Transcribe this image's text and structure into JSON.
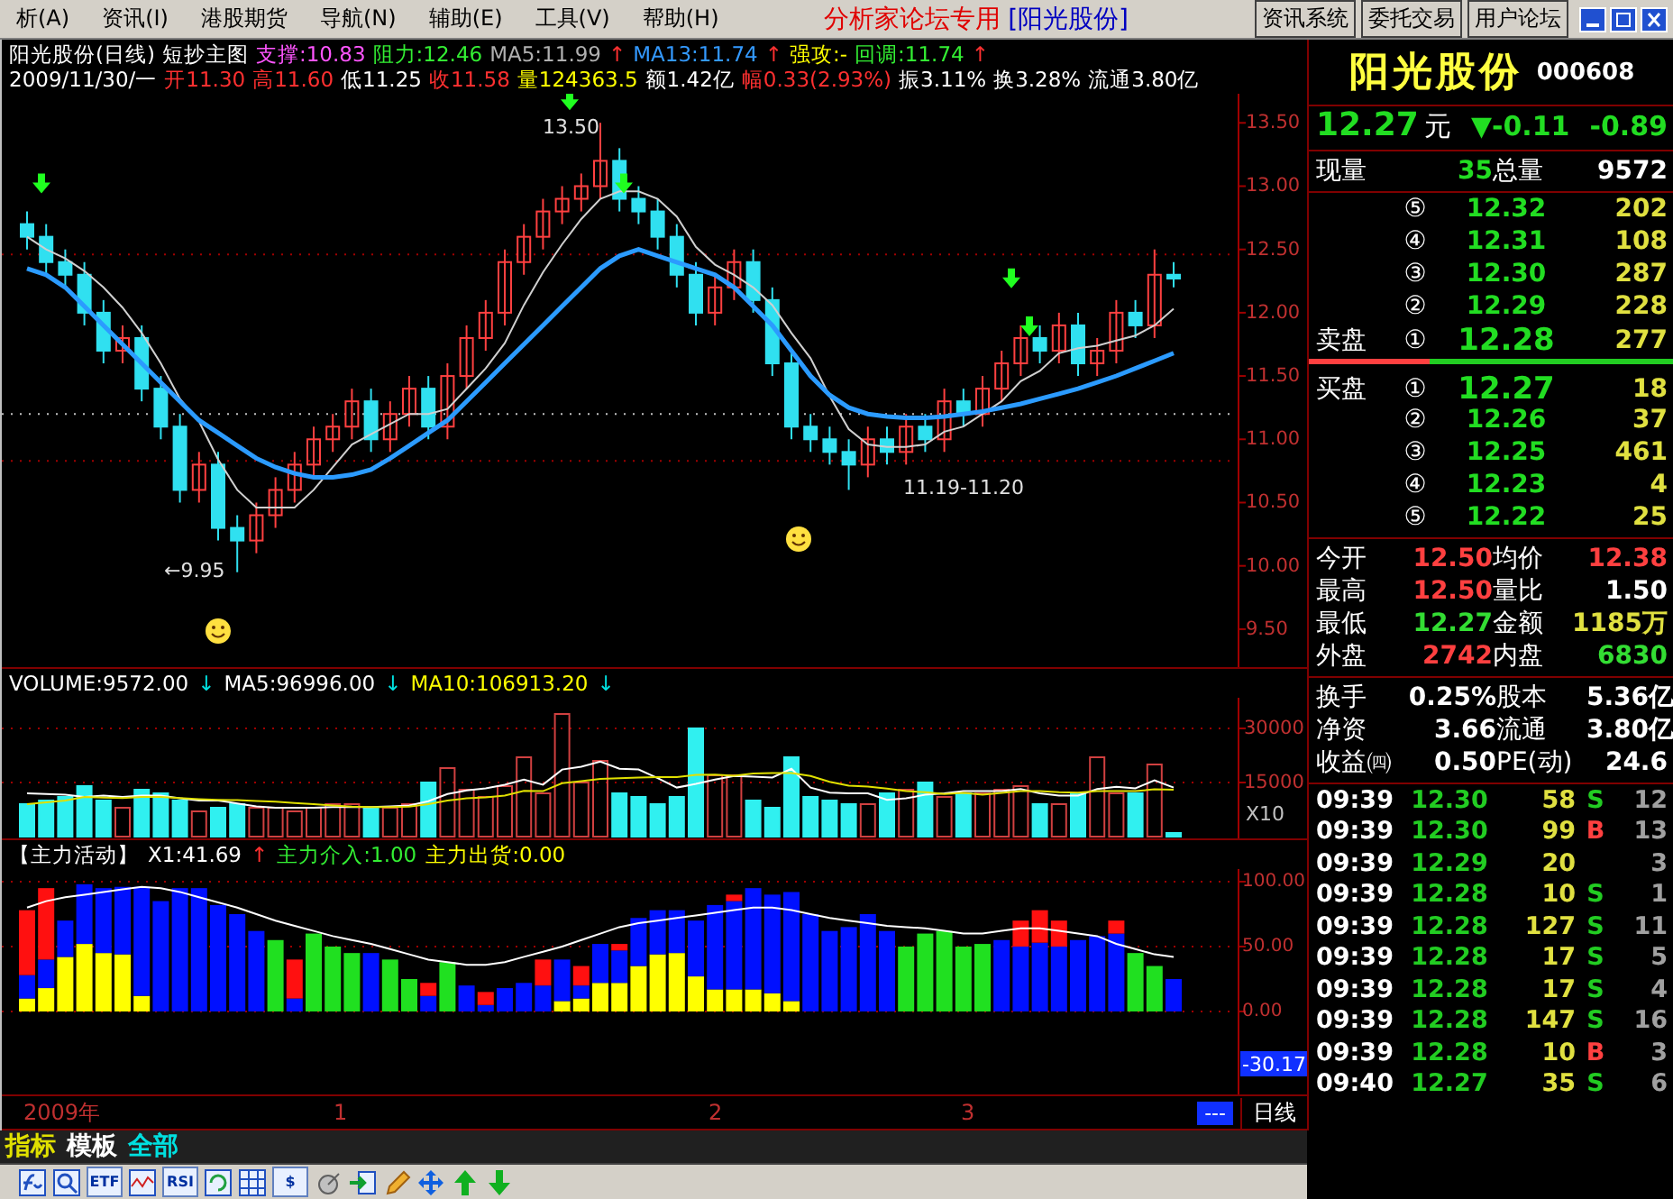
{
  "menu": [
    "析(A)",
    "资讯(I)",
    "港股期货",
    "导航(N)",
    "辅助(E)",
    "工具(V)",
    "帮助(H)"
  ],
  "banner": {
    "title": "分析家论坛专用",
    "stock": "[阳光股份]"
  },
  "top_buttons": [
    "资讯系统",
    "委托交易",
    "用户论坛"
  ],
  "chart_header": {
    "line1": [
      {
        "text": "阳光股份(日线)",
        "color": "#ffffff"
      },
      {
        "text": "短抄主图",
        "color": "#ffffff"
      },
      {
        "text": "支撑:10.83",
        "color": "#ff55ff"
      },
      {
        "text": "阻力:12.46",
        "color": "#33ee33"
      },
      {
        "text": "MA5:11.99",
        "color": "#b0b0b0"
      },
      {
        "text": "↑",
        "color": "#ff3030"
      },
      {
        "text": "MA13:11.74",
        "color": "#3399ff"
      },
      {
        "text": "↑",
        "color": "#ff3030"
      },
      {
        "text": "强攻:-",
        "color": "#ffff00"
      },
      {
        "text": "回调:11.74",
        "color": "#33ee33"
      },
      {
        "text": "↑",
        "color": "#ff3030"
      }
    ],
    "line2": [
      {
        "text": "2009/11/30/一",
        "color": "#ffffff"
      },
      {
        "text": "开11.30",
        "color": "#ff3030"
      },
      {
        "text": "高11.60",
        "color": "#ff3030"
      },
      {
        "text": "低11.25",
        "color": "#ffffff"
      },
      {
        "text": "收11.58",
        "color": "#ff3030"
      },
      {
        "text": "量124363.5",
        "color": "#ffff00"
      },
      {
        "text": "额1.42亿",
        "color": "#ffffff"
      },
      {
        "text": "幅0.33(2.93%)",
        "color": "#ff3030"
      },
      {
        "text": "振3.11%",
        "color": "#ffffff"
      },
      {
        "text": "换3.28%",
        "color": "#ffffff"
      },
      {
        "text": "流通3.80亿",
        "color": "#ffffff"
      }
    ]
  },
  "price_chart": {
    "chart_data": {
      "type": "candlestick",
      "ylim": [
        9.2,
        13.73
      ],
      "yticks": [
        {
          "value": 13.5,
          "label": "13.50"
        },
        {
          "value": 13.0,
          "label": "13.00"
        },
        {
          "value": 12.5,
          "label": "12.50"
        },
        {
          "value": 12.0,
          "label": "12.00"
        },
        {
          "value": 11.5,
          "label": "11.50"
        },
        {
          "value": 11.0,
          "label": "11.00"
        },
        {
          "value": 10.5,
          "label": "10.50"
        },
        {
          "value": 10.0,
          "label": "10.00"
        },
        {
          "value": 9.5,
          "label": "9.50"
        }
      ],
      "ohlc": [
        [
          12.7,
          12.8,
          12.5,
          12.6
        ],
        [
          12.6,
          12.7,
          12.3,
          12.4
        ],
        [
          12.4,
          12.5,
          12.2,
          12.3
        ],
        [
          12.3,
          12.4,
          11.9,
          12.0
        ],
        [
          12.0,
          12.1,
          11.6,
          11.7
        ],
        [
          11.7,
          11.9,
          11.6,
          11.8
        ],
        [
          11.8,
          11.9,
          11.3,
          11.4
        ],
        [
          11.4,
          11.5,
          11.0,
          11.1
        ],
        [
          11.1,
          11.2,
          10.5,
          10.6
        ],
        [
          10.6,
          10.9,
          10.5,
          10.8
        ],
        [
          10.8,
          10.9,
          10.2,
          10.3
        ],
        [
          10.3,
          10.4,
          9.95,
          10.2
        ],
        [
          10.2,
          10.5,
          10.1,
          10.4
        ],
        [
          10.4,
          10.7,
          10.3,
          10.6
        ],
        [
          10.6,
          10.9,
          10.5,
          10.8
        ],
        [
          10.8,
          11.1,
          10.7,
          11.0
        ],
        [
          11.0,
          11.2,
          10.9,
          11.1
        ],
        [
          11.1,
          11.4,
          11.0,
          11.3
        ],
        [
          11.3,
          11.4,
          10.9,
          11.0
        ],
        [
          11.0,
          11.3,
          10.9,
          11.2
        ],
        [
          11.2,
          11.5,
          11.1,
          11.4
        ],
        [
          11.4,
          11.5,
          11.0,
          11.1
        ],
        [
          11.1,
          11.6,
          11.0,
          11.5
        ],
        [
          11.5,
          11.9,
          11.4,
          11.8
        ],
        [
          11.8,
          12.1,
          11.7,
          12.0
        ],
        [
          12.0,
          12.5,
          11.9,
          12.4
        ],
        [
          12.4,
          12.7,
          12.3,
          12.6
        ],
        [
          12.6,
          12.9,
          12.5,
          12.8
        ],
        [
          12.8,
          13.0,
          12.7,
          12.9
        ],
        [
          12.9,
          13.1,
          12.8,
          13.0
        ],
        [
          13.0,
          13.5,
          12.9,
          13.2
        ],
        [
          13.2,
          13.3,
          12.8,
          12.9
        ],
        [
          12.9,
          13.0,
          12.7,
          12.8
        ],
        [
          12.8,
          12.9,
          12.5,
          12.6
        ],
        [
          12.6,
          12.7,
          12.2,
          12.3
        ],
        [
          12.3,
          12.4,
          11.9,
          12.0
        ],
        [
          12.0,
          12.3,
          11.9,
          12.2
        ],
        [
          12.2,
          12.5,
          12.1,
          12.4
        ],
        [
          12.4,
          12.5,
          12.0,
          12.1
        ],
        [
          12.1,
          12.2,
          11.5,
          11.6
        ],
        [
          11.6,
          11.7,
          11.0,
          11.1
        ],
        [
          11.1,
          11.2,
          10.9,
          11.0
        ],
        [
          11.0,
          11.1,
          10.8,
          10.9
        ],
        [
          10.9,
          11.0,
          10.6,
          10.8
        ],
        [
          10.8,
          11.1,
          10.7,
          11.0
        ],
        [
          11.0,
          11.1,
          10.8,
          10.9
        ],
        [
          10.9,
          11.2,
          10.8,
          11.1
        ],
        [
          11.1,
          11.2,
          10.9,
          11.0
        ],
        [
          11.0,
          11.4,
          10.9,
          11.3
        ],
        [
          11.3,
          11.4,
          11.1,
          11.2
        ],
        [
          11.2,
          11.5,
          11.1,
          11.4
        ],
        [
          11.4,
          11.7,
          11.3,
          11.6
        ],
        [
          11.6,
          11.9,
          11.5,
          11.8
        ],
        [
          11.8,
          11.9,
          11.6,
          11.7
        ],
        [
          11.7,
          12.0,
          11.6,
          11.9
        ],
        [
          11.9,
          12.0,
          11.5,
          11.6
        ],
        [
          11.6,
          11.8,
          11.5,
          11.7
        ],
        [
          11.7,
          12.1,
          11.6,
          12.0
        ],
        [
          12.0,
          12.1,
          11.8,
          11.9
        ],
        [
          11.9,
          12.5,
          11.8,
          12.3
        ],
        [
          12.3,
          12.4,
          12.2,
          12.27
        ]
      ],
      "series": [
        {
          "type": "line",
          "color": "#d0d0d0",
          "values": [
            12.6,
            12.5,
            12.43,
            12.33,
            12.2,
            12.04,
            11.84,
            11.6,
            11.32,
            11.14,
            10.84,
            10.6,
            10.46,
            10.46,
            10.46,
            10.6,
            10.78,
            10.96,
            11.04,
            11.12,
            11.2,
            11.2,
            11.24,
            11.4,
            11.56,
            11.76,
            12.06,
            12.32,
            12.54,
            12.74,
            12.9,
            12.96,
            12.96,
            12.9,
            12.76,
            12.52,
            12.38,
            12.3,
            12.2,
            12.06,
            11.84,
            11.64,
            11.34,
            11.08,
            10.96,
            10.94,
            10.94,
            10.96,
            11.06,
            11.1,
            11.2,
            11.3,
            11.46,
            11.54,
            11.68,
            11.72,
            11.74,
            11.78,
            11.82,
            11.9,
            12.03
          ]
        },
        {
          "type": "line",
          "color": "#2b9bff",
          "values": [
            12.35,
            12.3,
            12.2,
            12.05,
            11.9,
            11.75,
            11.6,
            11.45,
            11.3,
            11.15,
            11.05,
            10.95,
            10.85,
            10.78,
            10.73,
            10.7,
            10.7,
            10.72,
            10.76,
            10.85,
            10.95,
            11.05,
            11.15,
            11.3,
            11.45,
            11.6,
            11.75,
            11.9,
            12.05,
            12.2,
            12.35,
            12.45,
            12.5,
            12.45,
            12.4,
            12.35,
            12.3,
            12.2,
            12.05,
            11.9,
            11.7,
            11.5,
            11.35,
            11.25,
            11.2,
            11.18,
            11.17,
            11.17,
            11.18,
            11.2,
            11.22,
            11.25,
            11.28,
            11.32,
            11.36,
            11.4,
            11.45,
            11.5,
            11.56,
            11.62,
            11.68
          ]
        }
      ],
      "ref_lines": [
        {
          "axis": "y",
          "value": 10.83,
          "color": "#a00000"
        },
        {
          "axis": "y",
          "value": 12.46,
          "color": "#a00000"
        },
        {
          "axis": "y",
          "value": 11.2,
          "color": "#c0c0c0"
        }
      ]
    },
    "annotations": [
      {
        "kind": "peak",
        "text": "13.50"
      },
      {
        "kind": "low",
        "text": "←9.95"
      },
      {
        "kind": "range",
        "text": "11.19-11.20"
      }
    ]
  },
  "volume_chart": {
    "header": [
      {
        "text": "VOLUME:9572.00",
        "color": "#ffffff"
      },
      {
        "text": "↓",
        "color": "#00e0e0"
      },
      {
        "text": "MA5:96996.00",
        "color": "#ffffff"
      },
      {
        "text": "↓",
        "color": "#00e0e0"
      },
      {
        "text": "MA10:106913.20",
        "color": "#ffff00"
      },
      {
        "text": "↓",
        "color": "#00e0e0"
      }
    ],
    "chart_data": {
      "type": "bar",
      "grid": true,
      "ylim": [
        -1000,
        38500
      ],
      "yticks": [
        {
          "value": 30000,
          "label": "30000"
        },
        {
          "value": 15000,
          "label": "15000"
        }
      ],
      "series": [
        {
          "type": "bar",
          "colors": [
            "#30f0f0",
            "#30f0f0",
            "#30f0f0",
            "#30f0f0",
            "#30f0f0",
            "#d04040",
            "#30f0f0",
            "#30f0f0",
            "#30f0f0",
            "#d04040",
            "#30f0f0",
            "#30f0f0",
            "#d04040",
            "#d04040",
            "#d04040",
            "#d04040",
            "#d04040",
            "#d04040",
            "#30f0f0",
            "#d04040",
            "#d04040",
            "#30f0f0",
            "#d04040",
            "#d04040",
            "#d04040",
            "#d04040",
            "#d04040",
            "#d04040",
            "#d04040",
            "#d04040",
            "#d04040",
            "#30f0f0",
            "#30f0f0",
            "#30f0f0",
            "#30f0f0",
            "#30f0f0",
            "#d04040",
            "#d04040",
            "#30f0f0",
            "#30f0f0",
            "#30f0f0",
            "#30f0f0",
            "#30f0f0",
            "#30f0f0",
            "#d04040",
            "#30f0f0",
            "#d04040",
            "#30f0f0",
            "#d04040",
            "#30f0f0",
            "#d04040",
            "#d04040",
            "#d04040",
            "#30f0f0",
            "#d04040",
            "#30f0f0",
            "#d04040",
            "#d04040",
            "#30f0f0",
            "#d04040",
            "#30f0f0"
          ],
          "values": [
            9000,
            10000,
            11000,
            14000,
            10000,
            8000,
            13000,
            12000,
            10000,
            7000,
            8000,
            9000,
            8000,
            8000,
            7000,
            8000,
            9000,
            9000,
            8000,
            8000,
            9000,
            15000,
            19000,
            13000,
            11000,
            14000,
            22000,
            12000,
            34000,
            15000,
            21000,
            12000,
            11000,
            9000,
            11000,
            30000,
            17000,
            17000,
            10000,
            8000,
            22000,
            11000,
            10000,
            9000,
            9000,
            12000,
            13000,
            15000,
            11000,
            12000,
            12000,
            13000,
            14000,
            9000,
            9000,
            12000,
            22000,
            12000,
            12000,
            20000,
            1000
          ]
        },
        {
          "type": "line",
          "color": "#ffffff",
          "values": [
            12000,
            11800,
            11600,
            11000,
            11400,
            11000,
            11400,
            11400,
            10600,
            10000,
            10000,
            9200,
            8400,
            8000,
            8000,
            8000,
            8200,
            8200,
            8200,
            8400,
            8600,
            9800,
            11800,
            12800,
            13400,
            14400,
            15800,
            14400,
            18600,
            19400,
            20800,
            18800,
            18600,
            16200,
            13600,
            14600,
            15800,
            16800,
            16600,
            16400,
            18800,
            13600,
            12200,
            12000,
            12000,
            10200,
            10600,
            11600,
            12000,
            12600,
            12600,
            12600,
            13200,
            12000,
            11400,
            11400,
            13200,
            13800,
            13400,
            15600,
            13600
          ]
        },
        {
          "type": "line",
          "color": "#e0e000",
          "values": [
            9000,
            9500,
            10000,
            11000,
            10800,
            10700,
            11000,
            11000,
            10700,
            10400,
            10200,
            10100,
            9900,
            9700,
            9300,
            9000,
            8600,
            8300,
            8200,
            8200,
            8300,
            9000,
            10000,
            10600,
            10900,
            11400,
            12700,
            12600,
            14800,
            15400,
            16000,
            16200,
            16400,
            16500,
            16500,
            17100,
            17200,
            16900,
            17500,
            17600,
            17600,
            16800,
            15200,
            14100,
            13900,
            13300,
            12600,
            12300,
            11800,
            12100,
            11600,
            12100,
            12600,
            12600,
            12300,
            12200,
            12600,
            12600,
            12600,
            13100,
            13000
          ]
        }
      ]
    },
    "scale": "X10"
  },
  "indicator_chart": {
    "header": [
      {
        "text": "【主力活动】",
        "color": "#ffffff"
      },
      {
        "text": "X1:41.69",
        "color": "#ffffff"
      },
      {
        "text": "↑",
        "color": "#ff3030"
      },
      {
        "text": "主力介入:1.00",
        "color": "#33ee33"
      },
      {
        "text": "主力出货:0.00",
        "color": "#ffff00"
      }
    ],
    "chart_data": {
      "type": "bar",
      "stacked": true,
      "grid": true,
      "ylim": [
        -65.3,
        109.7
      ],
      "yticks": [
        {
          "value": 100,
          "label": "100.00"
        },
        {
          "value": 50,
          "label": "50.00"
        },
        {
          "value": 0,
          "label": "0.00"
        }
      ],
      "series": [
        {
          "type": "bar",
          "color": "#ffff00",
          "values": [
            10,
            18,
            42,
            52,
            45,
            44,
            12,
            0,
            0,
            0,
            0,
            0,
            0,
            0,
            0,
            0,
            0,
            0,
            0,
            0,
            0,
            0,
            0,
            0,
            0,
            0,
            0,
            0,
            8,
            10,
            22,
            22,
            35,
            44,
            45,
            27,
            17,
            17,
            17,
            14,
            8,
            0,
            0,
            0,
            0,
            0,
            0,
            0,
            0,
            0,
            0,
            0,
            0,
            0,
            0,
            0,
            0,
            0,
            0,
            0,
            0
          ]
        },
        {
          "type": "bar",
          "color": "#0010ff",
          "values": [
            18,
            22,
            28,
            46,
            50,
            52,
            84,
            85,
            95,
            95,
            82,
            75,
            62,
            0,
            10,
            0,
            0,
            0,
            45,
            0,
            0,
            12,
            0,
            20,
            5,
            18,
            22,
            20,
            32,
            10,
            30,
            25,
            37,
            34,
            33,
            43,
            65,
            68,
            78,
            76,
            84,
            75,
            62,
            65,
            75,
            62,
            0,
            0,
            0,
            0,
            0,
            55,
            50,
            53,
            50,
            55,
            58,
            60,
            0,
            0,
            25
          ]
        },
        {
          "type": "bar",
          "color": "#20e020",
          "values": [
            0,
            0,
            0,
            0,
            0,
            0,
            0,
            0,
            0,
            0,
            0,
            0,
            0,
            55,
            0,
            60,
            50,
            45,
            0,
            40,
            25,
            0,
            38,
            0,
            0,
            0,
            0,
            0,
            0,
            0,
            0,
            0,
            0,
            0,
            0,
            0,
            0,
            0,
            0,
            0,
            0,
            0,
            0,
            0,
            0,
            0,
            50,
            60,
            62,
            50,
            52,
            0,
            0,
            0,
            0,
            0,
            0,
            0,
            45,
            35,
            0
          ]
        },
        {
          "type": "bar",
          "color": "#ff1010",
          "values": [
            50,
            55,
            0,
            0,
            0,
            0,
            0,
            0,
            0,
            0,
            0,
            0,
            0,
            0,
            30,
            0,
            0,
            0,
            0,
            0,
            0,
            10,
            0,
            0,
            10,
            0,
            0,
            20,
            0,
            15,
            0,
            5,
            0,
            0,
            0,
            0,
            0,
            5,
            0,
            0,
            0,
            0,
            0,
            0,
            0,
            0,
            0,
            0,
            0,
            0,
            0,
            0,
            20,
            25,
            20,
            0,
            0,
            10,
            0,
            0,
            0
          ]
        },
        {
          "type": "line",
          "color": "#ffffff",
          "values": [
            80,
            85,
            88,
            90,
            92,
            94,
            96,
            95,
            92,
            88,
            84,
            80,
            75,
            70,
            66,
            62,
            58,
            55,
            52,
            48,
            44,
            40,
            38,
            36,
            36,
            38,
            42,
            46,
            50,
            55,
            60,
            65,
            68,
            70,
            72,
            74,
            76,
            78,
            80,
            80,
            78,
            75,
            72,
            70,
            68,
            66,
            65,
            64,
            62,
            60,
            60,
            62,
            64,
            64,
            62,
            60,
            58,
            52,
            48,
            44,
            42
          ]
        }
      ]
    },
    "current": "-30.17"
  },
  "time_axis": {
    "labels": [
      "2009年",
      "1",
      "2",
      "3"
    ],
    "marker": "---",
    "period": "日线"
  },
  "bottom_tabs": [
    {
      "label": "指标",
      "color": "#e0e000"
    },
    {
      "label": "模板",
      "color": "#ffffff"
    },
    {
      "label": "全部",
      "color": "#00e0e0"
    }
  ],
  "toolbar": [
    {
      "kind": "formula"
    },
    {
      "kind": "search"
    },
    {
      "kind": "text",
      "label": "ETF"
    },
    {
      "kind": "wave"
    },
    {
      "kind": "text",
      "label": "RSI"
    },
    {
      "kind": "refresh"
    },
    {
      "kind": "grid"
    },
    {
      "kind": "text",
      "label": "$"
    },
    {
      "kind": "satellite"
    },
    {
      "kind": "enter"
    },
    {
      "kind": "pencil"
    },
    {
      "kind": "move"
    },
    {
      "kind": "up"
    },
    {
      "kind": "down"
    }
  ],
  "quote": {
    "name": "阳光股份",
    "code": "000608",
    "price": "12.27",
    "unit": "元",
    "change": "▼-0.11",
    "change_pct": "-0.89"
  },
  "volume_summary": [
    {
      "label": "现量",
      "value": "35"
    },
    {
      "label": "总量",
      "value": "9572"
    }
  ],
  "asks": [
    {
      "level": "⑤",
      "price": "12.32",
      "qty": "202"
    },
    {
      "level": "④",
      "price": "12.31",
      "qty": "108"
    },
    {
      "level": "③",
      "price": "12.30",
      "qty": "287"
    },
    {
      "level": "②",
      "price": "12.29",
      "qty": "228"
    },
    {
      "side": "卖盘",
      "level": "①",
      "price": "12.28",
      "qty": "277"
    }
  ],
  "order_bar": {
    "level": 0.33
  },
  "bids": [
    {
      "side": "买盘",
      "level": "①",
      "price": "12.27",
      "qty": "18"
    },
    {
      "level": "②",
      "price": "12.26",
      "qty": "37"
    },
    {
      "level": "③",
      "price": "12.25",
      "qty": "461"
    },
    {
      "level": "④",
      "price": "12.23",
      "qty": "4"
    },
    {
      "level": "⑤",
      "price": "12.22",
      "qty": "25"
    }
  ],
  "stats": [
    {
      "cells": [
        {
          "label": "今开",
          "value": "12.50",
          "color": "#ff4040"
        },
        {
          "label": "均价",
          "value": "12.38",
          "color": "#ff4040"
        }
      ]
    },
    {
      "cells": [
        {
          "label": "最高",
          "value": "12.50",
          "color": "#ff4040"
        },
        {
          "label": "量比",
          "value": "1.50",
          "color": "#ffffff"
        }
      ]
    },
    {
      "cells": [
        {
          "label": "最低",
          "value": "12.27",
          "color": "#33dd33"
        },
        {
          "label": "金额",
          "value": "1185万",
          "color": "#e0e040"
        }
      ]
    },
    {
      "cells": [
        {
          "label": "外盘",
          "value": "2742",
          "color": "#ff4040"
        },
        {
          "label": "内盘",
          "value": "6830",
          "color": "#33dd33"
        }
      ]
    }
  ],
  "fundamentals": [
    {
      "cells": [
        {
          "label": "换手",
          "value": "0.25%"
        },
        {
          "label": "股本",
          "value": "5.36亿"
        }
      ]
    },
    {
      "cells": [
        {
          "label": "净资",
          "value": "3.66"
        },
        {
          "label": "流通",
          "value": "3.80亿"
        }
      ]
    },
    {
      "cells": [
        {
          "label": "收益㈣",
          "value": "0.50"
        },
        {
          "label": "PE(动)",
          "value": "24.6"
        }
      ]
    }
  ],
  "trades": [
    {
      "time": "09:39",
      "price": "12.30",
      "volume": "58",
      "side": "S",
      "kind": "sell",
      "count": "12"
    },
    {
      "time": "09:39",
      "price": "12.30",
      "volume": "99",
      "side": "B",
      "kind": "buy",
      "count": "13"
    },
    {
      "time": "09:39",
      "price": "12.29",
      "volume": "20",
      "count": "3"
    },
    {
      "time": "09:39",
      "price": "12.28",
      "volume": "10",
      "side": "S",
      "kind": "sell",
      "count": "1"
    },
    {
      "time": "09:39",
      "price": "12.28",
      "volume": "127",
      "side": "S",
      "kind": "sell",
      "count": "11"
    },
    {
      "time": "09:39",
      "price": "12.28",
      "volume": "17",
      "side": "S",
      "kind": "sell",
      "count": "5"
    },
    {
      "time": "09:39",
      "price": "12.28",
      "volume": "17",
      "side": "S",
      "kind": "sell",
      "count": "4"
    },
    {
      "time": "09:39",
      "price": "12.28",
      "volume": "147",
      "side": "S",
      "kind": "sell",
      "count": "16"
    },
    {
      "time": "09:39",
      "price": "12.28",
      "volume": "10",
      "side": "B",
      "kind": "buy",
      "count": "3"
    },
    {
      "time": "09:40",
      "price": "12.27",
      "volume": "35",
      "side": "S",
      "kind": "sell",
      "count": "6"
    }
  ]
}
